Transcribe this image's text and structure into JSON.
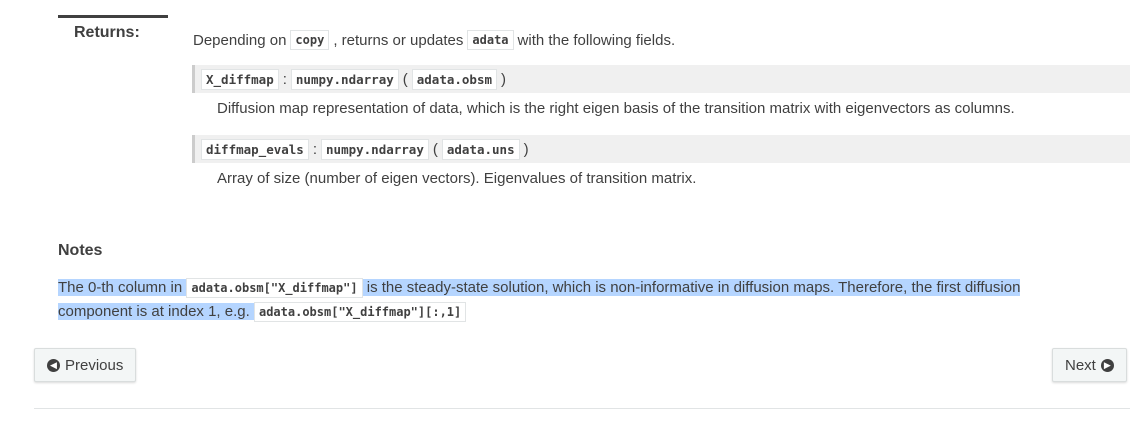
{
  "returns": {
    "label": "Returns:",
    "desc_prefix": "Depending on",
    "copy_code": "copy",
    "desc_mid": ", returns or updates",
    "adata_code": "adata",
    "desc_suffix": "with the following fields.",
    "fields": [
      {
        "name": "X_diffmap",
        "colon": ":",
        "type": "numpy.ndarray",
        "paren_open": "(",
        "location": "adata.obsm",
        "paren_close": ")",
        "description": "Diffusion map representation of data, which is the right eigen basis of the transition matrix with eigenvectors as columns."
      },
      {
        "name": "diffmap_evals",
        "colon": ":",
        "type": "numpy.ndarray",
        "paren_open": "(",
        "location": "adata.uns",
        "paren_close": ")",
        "description": "Array of size (number of eigen vectors). Eigenvalues of transition matrix."
      }
    ]
  },
  "notes": {
    "title": "Notes",
    "text_1": "The 0-th column in",
    "code_1": "adata.obsm[\"X_diffmap\"]",
    "text_2": "is the steady-state solution, which is non-informative in diffusion maps. Therefore, the first diffusion component is at index 1, e.g.",
    "code_2": "adata.obsm[\"X_diffmap\"][:,1]"
  },
  "nav": {
    "previous_label": "Previous",
    "next_label": "Next",
    "previous_icon": "arrow-circle-left-icon",
    "next_icon": "arrow-circle-right-icon"
  },
  "colors": {
    "text": "#404040",
    "selection": "#b5d5ff",
    "field_bg": "#f0f0f0"
  }
}
